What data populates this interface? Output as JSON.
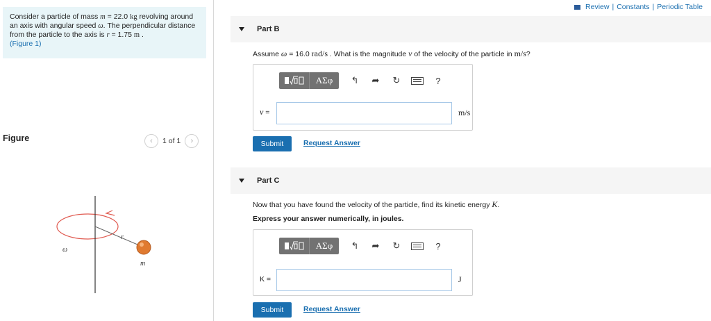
{
  "nav": {
    "review": "Review",
    "constants": "Constants",
    "periodic": "Periodic Table",
    "separator": "|"
  },
  "problem": {
    "t1": "Consider a particle of mass ",
    "m_sym": "m",
    "t2": " = 22.0 ",
    "m_unit": "kg",
    "t3": " revolving around an axis with angular speed ",
    "w_sym": "ω",
    "t4": ". The perpendicular distance from the particle to the axis is ",
    "r_sym": "r",
    "t5": " = 1.75 ",
    "r_unit": "m",
    "t6": " .",
    "fig_link": "(Figure 1)"
  },
  "figure": {
    "title": "Figure",
    "pager": "1 of 1",
    "labels": {
      "omega": "ω",
      "r": "r",
      "m": "m"
    }
  },
  "partB": {
    "title": "Part B",
    "q1": "Assume ",
    "q_w": "ω",
    "q2": " = 16.0 ",
    "q_unit": "rad/s",
    "q3": " . What is the magnitude ",
    "q_v": "v",
    "q4": " of the velocity of the particle in ",
    "q_unit2": "m/s",
    "q5": "?",
    "var": "v",
    "eq": " =",
    "input_value": "",
    "unit": "m/s",
    "submit": "Submit",
    "request": "Request Answer"
  },
  "partC": {
    "title": "Part C",
    "q1": "Now that you have found the velocity of the particle, find its kinetic energy ",
    "q_k": "K",
    "q2": ".",
    "instruction": "Express your answer numerically, in joules.",
    "label": "K =",
    "input_value": "",
    "unit": "J",
    "submit": "Submit",
    "request": "Request Answer"
  },
  "toolbar": {
    "greek": "ΑΣφ",
    "help": "?"
  }
}
